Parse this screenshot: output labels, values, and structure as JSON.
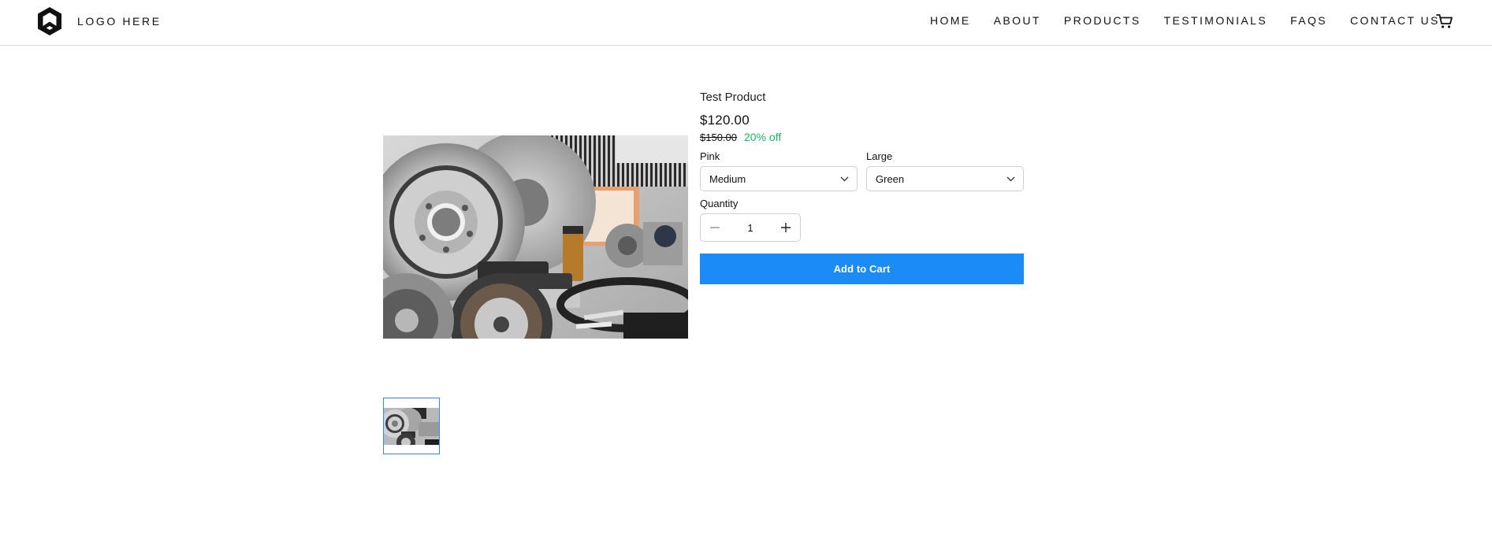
{
  "header": {
    "logo_text": "LOGO HERE",
    "nav": [
      "HOME",
      "ABOUT",
      "PRODUCTS",
      "TESTIMONIALS",
      "FAQS",
      "CONTACT US"
    ]
  },
  "gallery": {
    "main_image_icon": "auto-parts-photo",
    "thumbnail_icon": "auto-parts-thumbnail"
  },
  "product": {
    "title": "Test Product",
    "price": "$120.00",
    "old_price": "$150.00",
    "discount": "20% off",
    "option1": {
      "label": "Pink",
      "value": "Medium"
    },
    "option2": {
      "label": "Large",
      "value": "Green"
    },
    "quantity_label": "Quantity",
    "quantity": "1",
    "add_to_cart": "Add to Cart"
  },
  "colors": {
    "accent": "#1b8bf5",
    "discount": "#1bb861",
    "thumb_border": "#3b82f6"
  }
}
